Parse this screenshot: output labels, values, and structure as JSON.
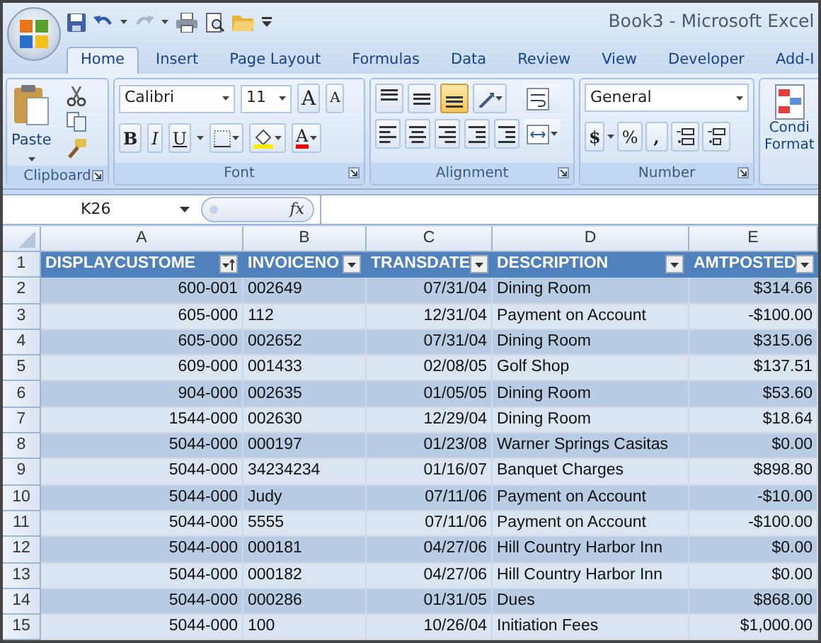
{
  "window": {
    "title": "Book3 - Microsoft Excel"
  },
  "tabs": [
    {
      "label": "Home",
      "selected": true
    },
    {
      "label": "Insert",
      "selected": false
    },
    {
      "label": "Page Layout",
      "selected": false
    },
    {
      "label": "Formulas",
      "selected": false
    },
    {
      "label": "Data",
      "selected": false
    },
    {
      "label": "Review",
      "selected": false
    },
    {
      "label": "View",
      "selected": false
    },
    {
      "label": "Developer",
      "selected": false
    },
    {
      "label": "Add-I",
      "selected": false
    }
  ],
  "ribbon": {
    "clipboard": {
      "label": "Clipboard",
      "paste": "Paste"
    },
    "font": {
      "label": "Font",
      "name": "Calibri",
      "size": "11",
      "grow": "A",
      "shrink": "A",
      "bold": "B",
      "italic": "I",
      "underline": "U",
      "font_color_label": "A"
    },
    "alignment": {
      "label": "Alignment",
      "vertical": [
        {
          "selected": false
        },
        {
          "selected": false
        },
        {
          "selected": true
        }
      ]
    },
    "number": {
      "label": "Number",
      "format": "General",
      "currency": "$",
      "percent": "%",
      "comma": ","
    },
    "styles": {
      "conditional": [
        "Condi",
        "Format"
      ]
    }
  },
  "formula_bar": {
    "name_box": "K26",
    "function_label": "fx"
  },
  "sheet": {
    "column_letters": [
      "A",
      "B",
      "C",
      "D",
      "E"
    ],
    "headers": [
      {
        "text": "DISPLAYCUSTOME",
        "sorted": true
      },
      {
        "text": "INVOICENO",
        "sorted": false
      },
      {
        "text": "TRANSDATE",
        "sorted": false
      },
      {
        "text": "DESCRIPTION",
        "sorted": false
      },
      {
        "text": "AMTPOSTED",
        "sorted": false
      }
    ],
    "header_row_number": "1",
    "rows": [
      {
        "number": "2",
        "cells": [
          "600-001",
          "002649",
          "07/31/04",
          "Dining Room",
          "$314.66"
        ]
      },
      {
        "number": "3",
        "cells": [
          "605-000",
          "112",
          "12/31/04",
          "Payment on Account",
          "-$100.00"
        ]
      },
      {
        "number": "4",
        "cells": [
          "605-000",
          "002652",
          "07/31/04",
          "Dining Room",
          "$315.06"
        ]
      },
      {
        "number": "5",
        "cells": [
          "609-000",
          "001433",
          "02/08/05",
          "Golf Shop",
          "$137.51"
        ]
      },
      {
        "number": "6",
        "cells": [
          "904-000",
          "002635",
          "01/05/05",
          "Dining Room",
          "$53.60"
        ]
      },
      {
        "number": "7",
        "cells": [
          "1544-000",
          "002630",
          "12/29/04",
          "Dining Room",
          "$18.64"
        ]
      },
      {
        "number": "8",
        "cells": [
          "5044-000",
          "000197",
          "01/23/08",
          "Warner Springs Casitas",
          "$0.00"
        ]
      },
      {
        "number": "9",
        "cells": [
          "5044-000",
          "34234234",
          "01/16/07",
          "Banquet Charges",
          "$898.80"
        ]
      },
      {
        "number": "10",
        "cells": [
          "5044-000",
          "Judy",
          "07/11/06",
          "Payment on Account",
          "-$10.00"
        ]
      },
      {
        "number": "11",
        "cells": [
          "5044-000",
          "5555",
          "07/11/06",
          "Payment on Account",
          "-$100.00"
        ]
      },
      {
        "number": "12",
        "cells": [
          "5044-000",
          "000181",
          "04/27/06",
          "Hill Country Harbor Inn",
          "$0.00"
        ]
      },
      {
        "number": "13",
        "cells": [
          "5044-000",
          "000182",
          "04/27/06",
          "Hill Country Harbor Inn",
          "$0.00"
        ]
      },
      {
        "number": "14",
        "cells": [
          "5044-000",
          "000286",
          "01/31/05",
          "Dues",
          "$868.00"
        ]
      },
      {
        "number": "15",
        "cells": [
          "5044-000",
          "100",
          "10/26/04",
          "Initiation Fees",
          "$1,000.00"
        ]
      }
    ]
  }
}
